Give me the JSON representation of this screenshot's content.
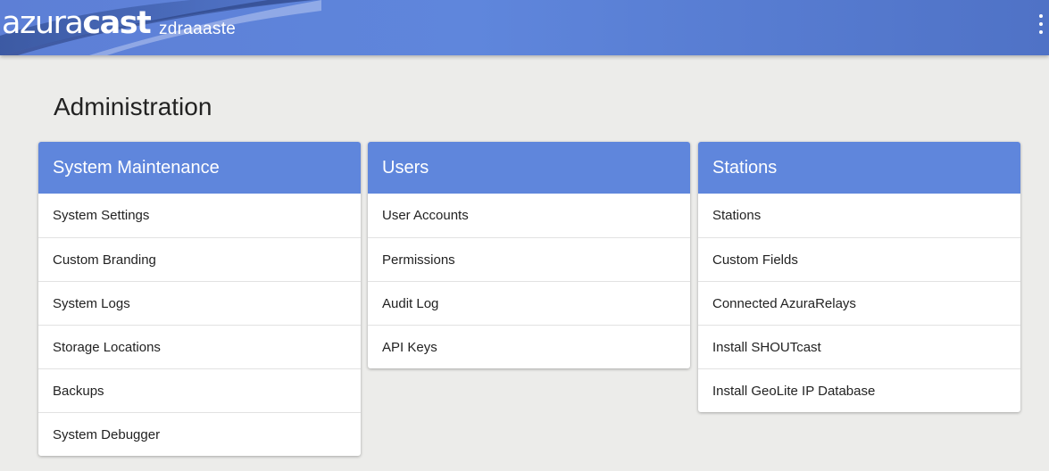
{
  "header": {
    "logo_light": "azura",
    "logo_bold": "cast",
    "instance_name": "zdraaaste"
  },
  "page_title": "Administration",
  "colors": {
    "header_blue": "#5f86dc",
    "background": "#ececea"
  },
  "panels": [
    {
      "title": "System Maintenance",
      "items": [
        "System Settings",
        "Custom Branding",
        "System Logs",
        "Storage Locations",
        "Backups",
        "System Debugger"
      ]
    },
    {
      "title": "Users",
      "items": [
        "User Accounts",
        "Permissions",
        "Audit Log",
        "API Keys"
      ]
    },
    {
      "title": "Stations",
      "items": [
        "Stations",
        "Custom Fields",
        "Connected AzuraRelays",
        "Install SHOUTcast",
        "Install GeoLite IP Database"
      ]
    }
  ]
}
